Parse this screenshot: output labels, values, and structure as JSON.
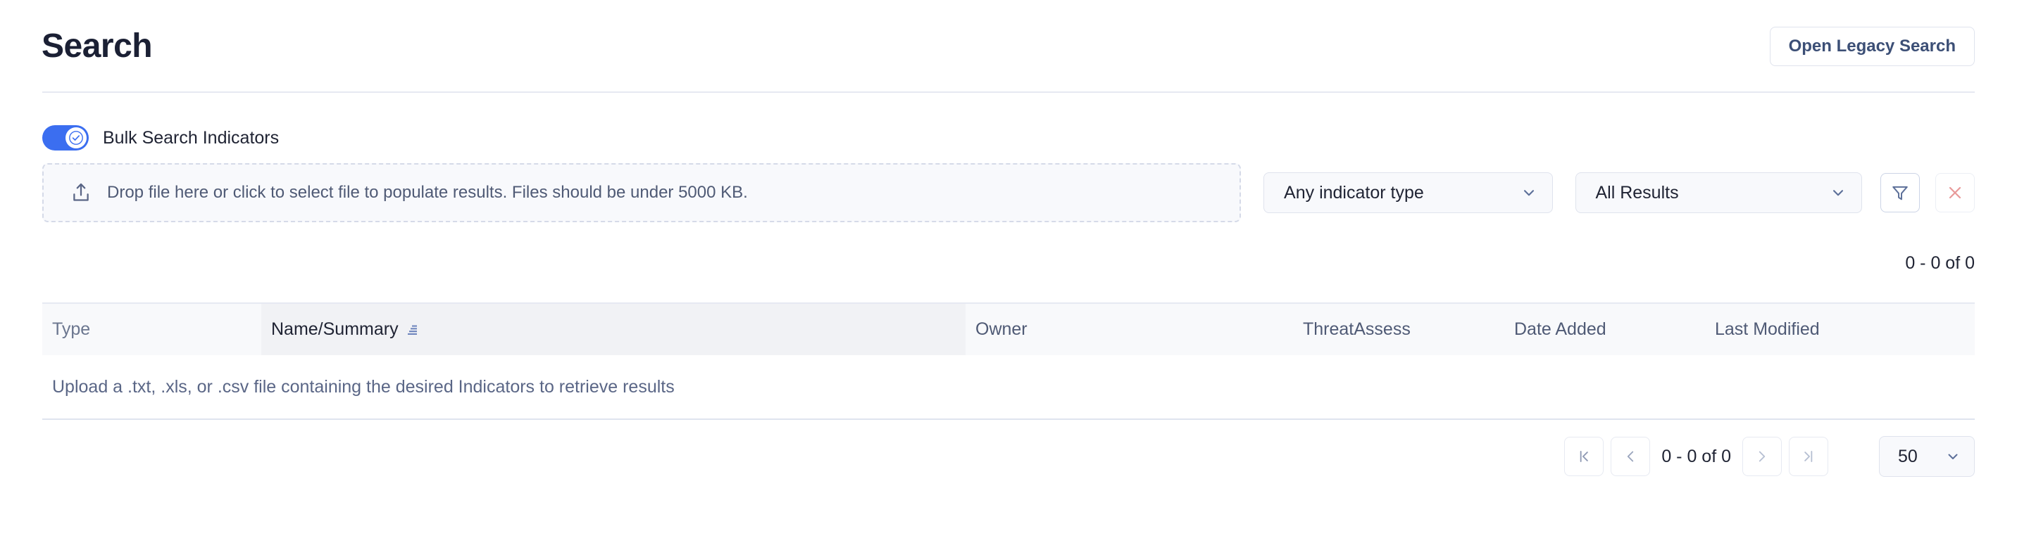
{
  "header": {
    "title": "Search",
    "legacy_button": "Open Legacy Search"
  },
  "bulk": {
    "toggle_label": "Bulk Search Indicators",
    "toggle_state": "on",
    "toggle_icon": "check-circle-icon",
    "accent_color": "#3b6ef0"
  },
  "dropzone": {
    "icon": "upload-icon",
    "text": "Drop file here or click to select file to populate results. Files should be under 5000 KB."
  },
  "filters": {
    "indicator_type": {
      "value": "Any indicator type",
      "icon": "chevron-down-icon"
    },
    "results_scope": {
      "value": "All Results",
      "icon": "chevron-down-icon"
    },
    "filter_button_icon": "funnel-icon",
    "clear_button_icon": "close-x-icon",
    "clear_color": "#e89a9a"
  },
  "results": {
    "count_label": "0 - 0 of 0"
  },
  "table": {
    "columns": [
      {
        "label": "Type",
        "sorted": false
      },
      {
        "label": "Name/Summary",
        "sorted": true,
        "sort_icon": "sort-ascending-icon"
      },
      {
        "label": "Owner",
        "sorted": false
      },
      {
        "label": "ThreatAssess",
        "sorted": false
      },
      {
        "label": "Date Added",
        "sorted": false
      },
      {
        "label": "Last Modified",
        "sorted": false
      }
    ],
    "empty_message": "Upload a .txt, .xls, or .csv file containing the desired Indicators to retrieve results"
  },
  "pagination": {
    "first_icon": "first-page-icon",
    "prev_icon": "chevron-left-icon",
    "range_label": "0 - 0 of 0",
    "next_icon": "chevron-right-icon",
    "last_icon": "last-page-icon",
    "page_size": "50",
    "page_size_icon": "chevron-down-icon"
  }
}
